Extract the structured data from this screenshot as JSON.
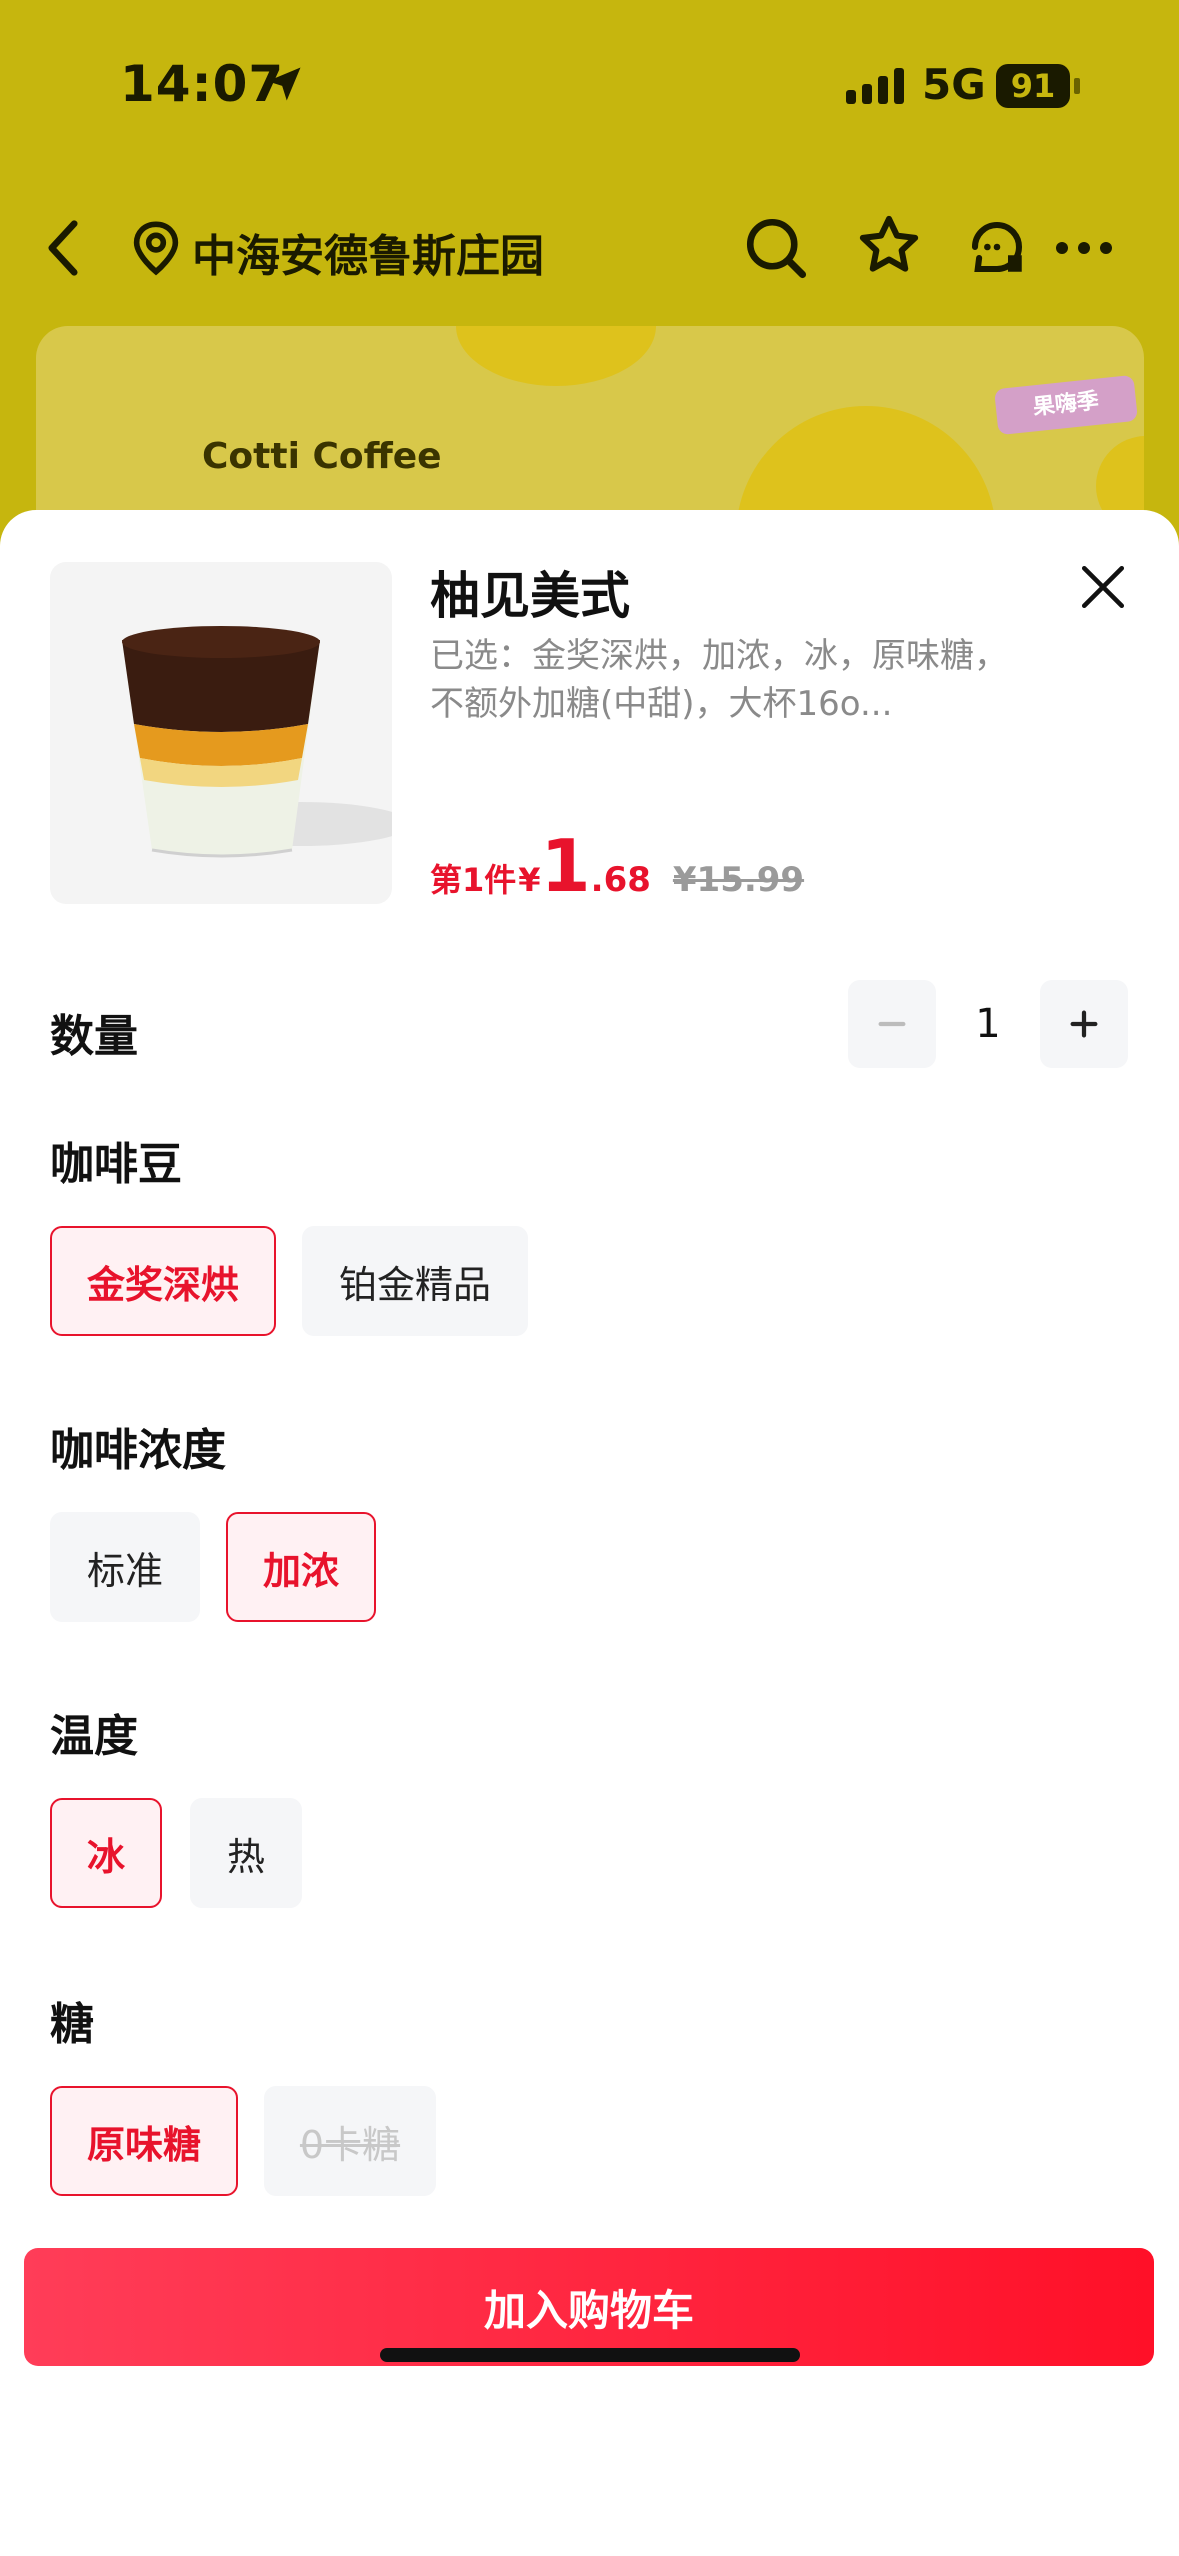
{
  "status_bar": {
    "time": "14:07",
    "network": "5G",
    "battery": "91"
  },
  "nav": {
    "store_name": "中海安德鲁斯庄园"
  },
  "banner": {
    "brand_text": "Cotti Coffee",
    "badge_text": "果嗨季"
  },
  "product": {
    "title": "柚见美式",
    "selected_summary": "已选：金奖深烘，加浓，冰，原味糖，不额外加糖(中甜)，大杯16o...",
    "price_prefix": "第1件",
    "currency": "¥",
    "price_int": "1",
    "price_dec": ".68",
    "original_price": "¥15.99"
  },
  "quantity": {
    "label": "数量",
    "value": "1"
  },
  "options": {
    "bean": {
      "label": "咖啡豆",
      "items": [
        {
          "label": "金奖深烘",
          "state": "active"
        },
        {
          "label": "铂金精品",
          "state": "normal"
        }
      ]
    },
    "strength": {
      "label": "咖啡浓度",
      "items": [
        {
          "label": "标准",
          "state": "normal"
        },
        {
          "label": "加浓",
          "state": "active"
        }
      ]
    },
    "temperature": {
      "label": "温度",
      "items": [
        {
          "label": "冰",
          "state": "active"
        },
        {
          "label": "热",
          "state": "normal"
        }
      ]
    },
    "sugar": {
      "label": "糖",
      "items": [
        {
          "label": "原味糖",
          "state": "active"
        },
        {
          "label": "0卡糖",
          "state": "disabled"
        }
      ]
    }
  },
  "cart_button": {
    "label": "加入购物车"
  },
  "colors": {
    "accent": "#e8132c",
    "header_bg": "#c6b60e",
    "option_bg": "#f5f6f8"
  }
}
